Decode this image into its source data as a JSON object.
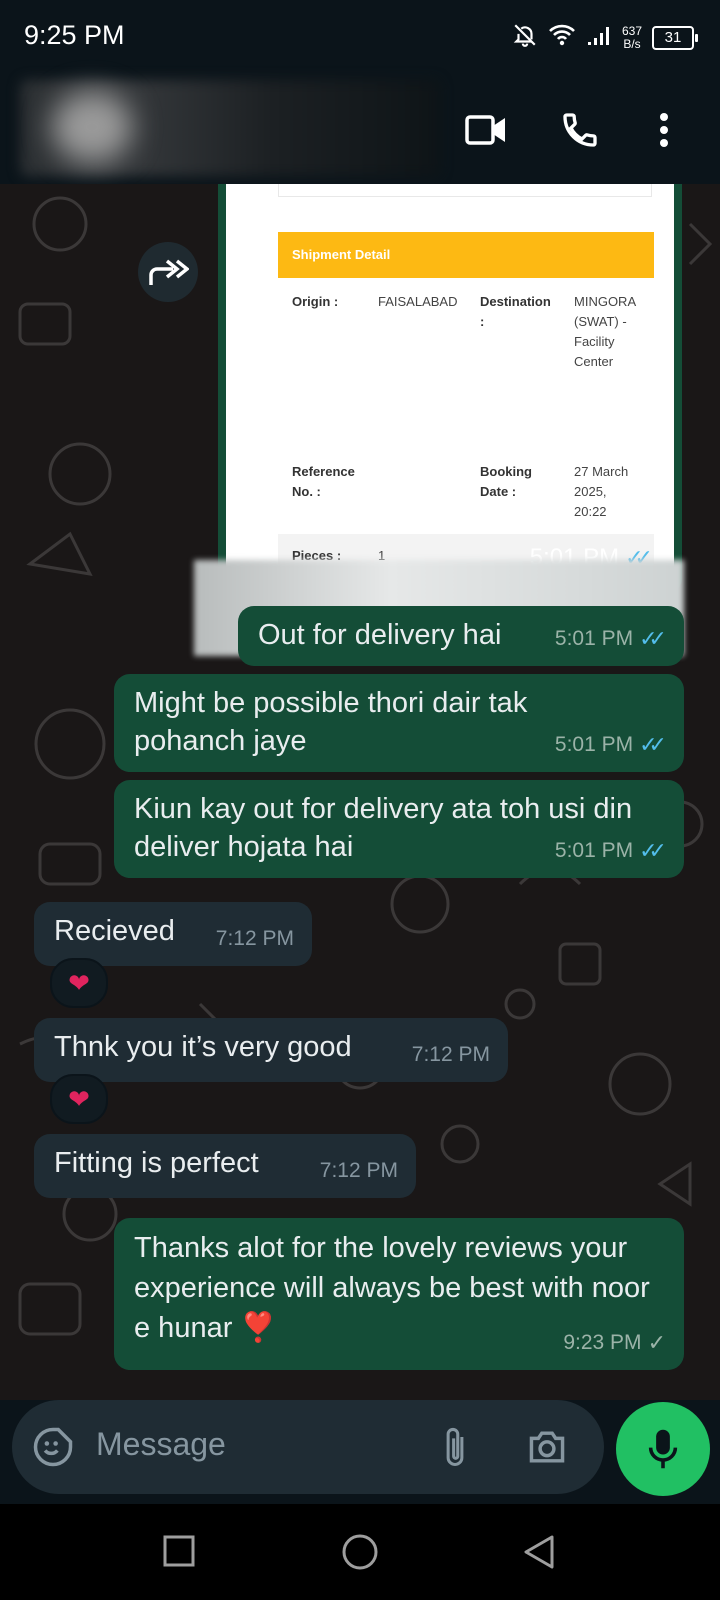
{
  "status_bar": {
    "time": "9:25 PM",
    "net_speed_value": "637",
    "net_speed_unit": "B/s",
    "battery": "31"
  },
  "header": {
    "icons": [
      "video-call-icon",
      "phone-icon",
      "more-vert-icon"
    ]
  },
  "shipment_doc": {
    "section_title": "Shipment Detail",
    "origin_label": "Origin :",
    "origin_value": "FAISALABAD",
    "destination_label_1": "Destination",
    "destination_label_2": ":",
    "destination_value_1": "MINGORA",
    "destination_value_2": "(SWAT) -",
    "destination_value_3": "Facility",
    "destination_value_4": "Center",
    "reference_label_1": "Reference",
    "reference_label_2": "No. :",
    "booking_label_1": "Booking",
    "booking_label_2": "Date :",
    "booking_value_1": "27 March",
    "booking_value_2": "2025,",
    "booking_value_3": "20:22",
    "pieces_label": "Pieces :",
    "pieces_value": "1",
    "time": "5:01 PM"
  },
  "messages": [
    {
      "direction": "out",
      "text": "Out for delivery hai",
      "time": "5:01 PM",
      "status": "read"
    },
    {
      "direction": "out",
      "text": "Might be possible thori dair tak pohanch jaye",
      "time": "5:01 PM",
      "status": "read"
    },
    {
      "direction": "out",
      "text": "Kiun kay out for delivery ata toh usi din deliver hojata hai",
      "time": "5:01 PM",
      "status": "read"
    },
    {
      "direction": "in",
      "text": "Recieved",
      "time": "7:12 PM",
      "reaction": "❤"
    },
    {
      "direction": "in",
      "text": "Thnk you it’s very good",
      "time": "7:12 PM",
      "reaction": "❤"
    },
    {
      "direction": "in",
      "text": "Fitting is perfect",
      "time": "7:12 PM"
    },
    {
      "direction": "out",
      "text": "Thanks alot for the lovely reviews your experience will always be best with noor e hunar ❣️",
      "time": "9:23 PM",
      "status": "sent"
    }
  ],
  "composer": {
    "placeholder": "Message"
  },
  "colors": {
    "outgoing_bubble": "#144d37",
    "incoming_bubble": "#1f2c34",
    "read_tick": "#53bdeb",
    "mic_button": "#21c063"
  }
}
